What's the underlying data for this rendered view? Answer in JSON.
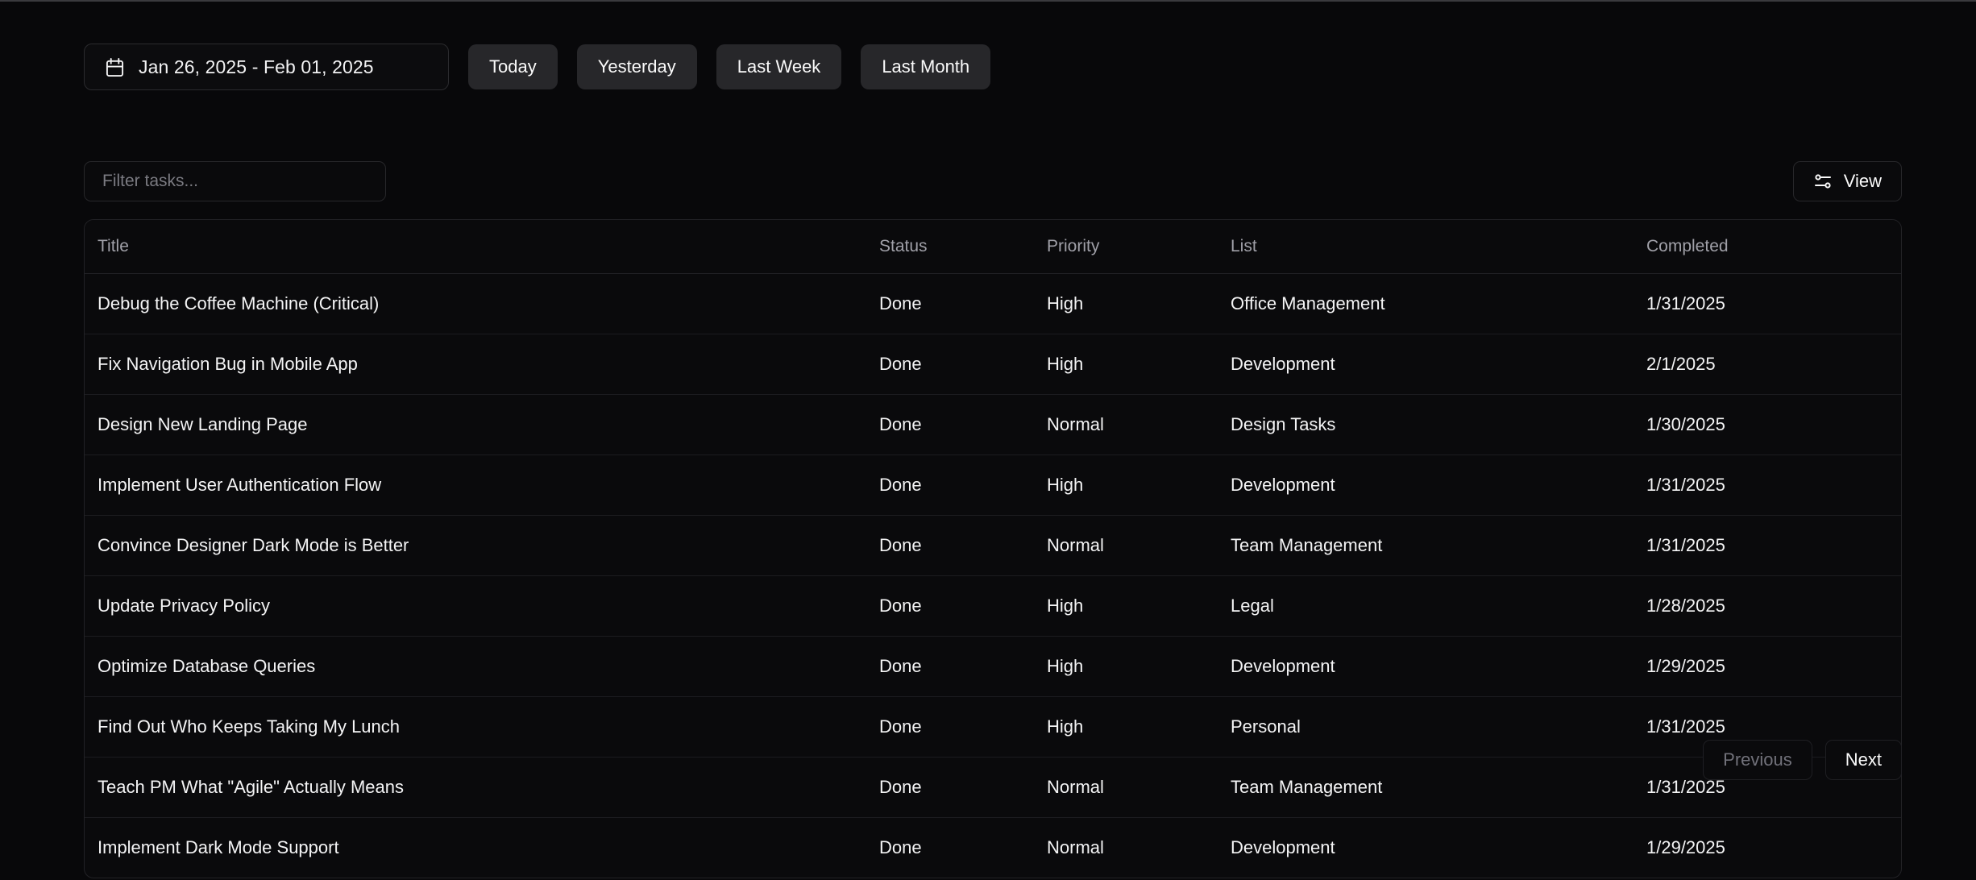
{
  "toolbar": {
    "date_range": "Jan 26, 2025 - Feb 01, 2025",
    "calendar_icon": "calendar-icon",
    "quick_ranges": [
      "Today",
      "Yesterday",
      "Last Week",
      "Last Month"
    ]
  },
  "filters": {
    "placeholder": "Filter tasks...",
    "value": "",
    "view_label": "View",
    "view_icon": "sliders-icon"
  },
  "table": {
    "columns": [
      "Title",
      "Status",
      "Priority",
      "List",
      "Completed"
    ],
    "rows": [
      {
        "title": "Debug the Coffee Machine (Critical)",
        "status": "Done",
        "priority": "High",
        "list": "Office Management",
        "completed": "1/31/2025"
      },
      {
        "title": "Fix Navigation Bug in Mobile App",
        "status": "Done",
        "priority": "High",
        "list": "Development",
        "completed": "2/1/2025"
      },
      {
        "title": "Design New Landing Page",
        "status": "Done",
        "priority": "Normal",
        "list": "Design Tasks",
        "completed": "1/30/2025"
      },
      {
        "title": "Implement User Authentication Flow",
        "status": "Done",
        "priority": "High",
        "list": "Development",
        "completed": "1/31/2025"
      },
      {
        "title": "Convince Designer Dark Mode is Better",
        "status": "Done",
        "priority": "Normal",
        "list": "Team Management",
        "completed": "1/31/2025"
      },
      {
        "title": "Update Privacy Policy",
        "status": "Done",
        "priority": "High",
        "list": "Legal",
        "completed": "1/28/2025"
      },
      {
        "title": "Optimize Database Queries",
        "status": "Done",
        "priority": "High",
        "list": "Development",
        "completed": "1/29/2025"
      },
      {
        "title": "Find Out Who Keeps Taking My Lunch",
        "status": "Done",
        "priority": "High",
        "list": "Personal",
        "completed": "1/31/2025"
      },
      {
        "title": "Teach PM What \"Agile\" Actually Means",
        "status": "Done",
        "priority": "Normal",
        "list": "Team Management",
        "completed": "1/31/2025"
      },
      {
        "title": "Implement Dark Mode Support",
        "status": "Done",
        "priority": "Normal",
        "list": "Development",
        "completed": "1/29/2025"
      }
    ]
  },
  "pagination": {
    "previous_label": "Previous",
    "next_label": "Next",
    "previous_disabled": true
  },
  "colors": {
    "background": "#08080a",
    "surface": "#0a0a0c",
    "border": "#222226",
    "quick_button": "#27272a",
    "text": "#fafafa",
    "muted_text": "#a0a0a8",
    "disabled_text": "#71717a"
  }
}
